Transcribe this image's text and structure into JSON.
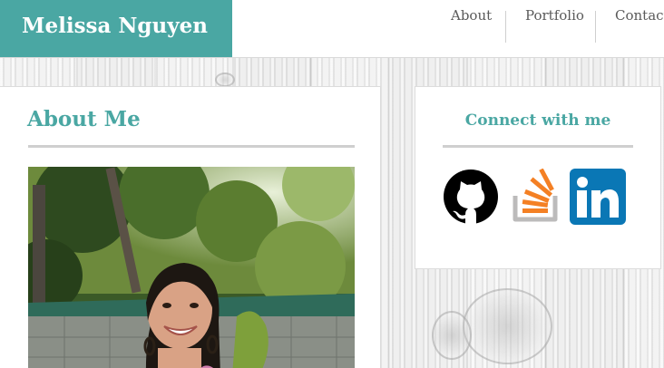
{
  "header": {
    "brand": "Melissa Nguyen",
    "nav": [
      {
        "label": "About"
      },
      {
        "label": "Portfolio"
      },
      {
        "label": "Contact"
      }
    ]
  },
  "about": {
    "title": "About Me",
    "photo_alt": "photo-of-melissa"
  },
  "connect": {
    "title": "Connect with me",
    "links": [
      {
        "name": "github-icon"
      },
      {
        "name": "stackoverflow-icon"
      },
      {
        "name": "linkedin-icon"
      }
    ]
  },
  "colors": {
    "accent": "#4aa7a3",
    "github": "#000000",
    "stackoverflow_orange": "#f48024",
    "stackoverflow_gray": "#bcbbbb",
    "linkedin": "#0a77b5"
  }
}
